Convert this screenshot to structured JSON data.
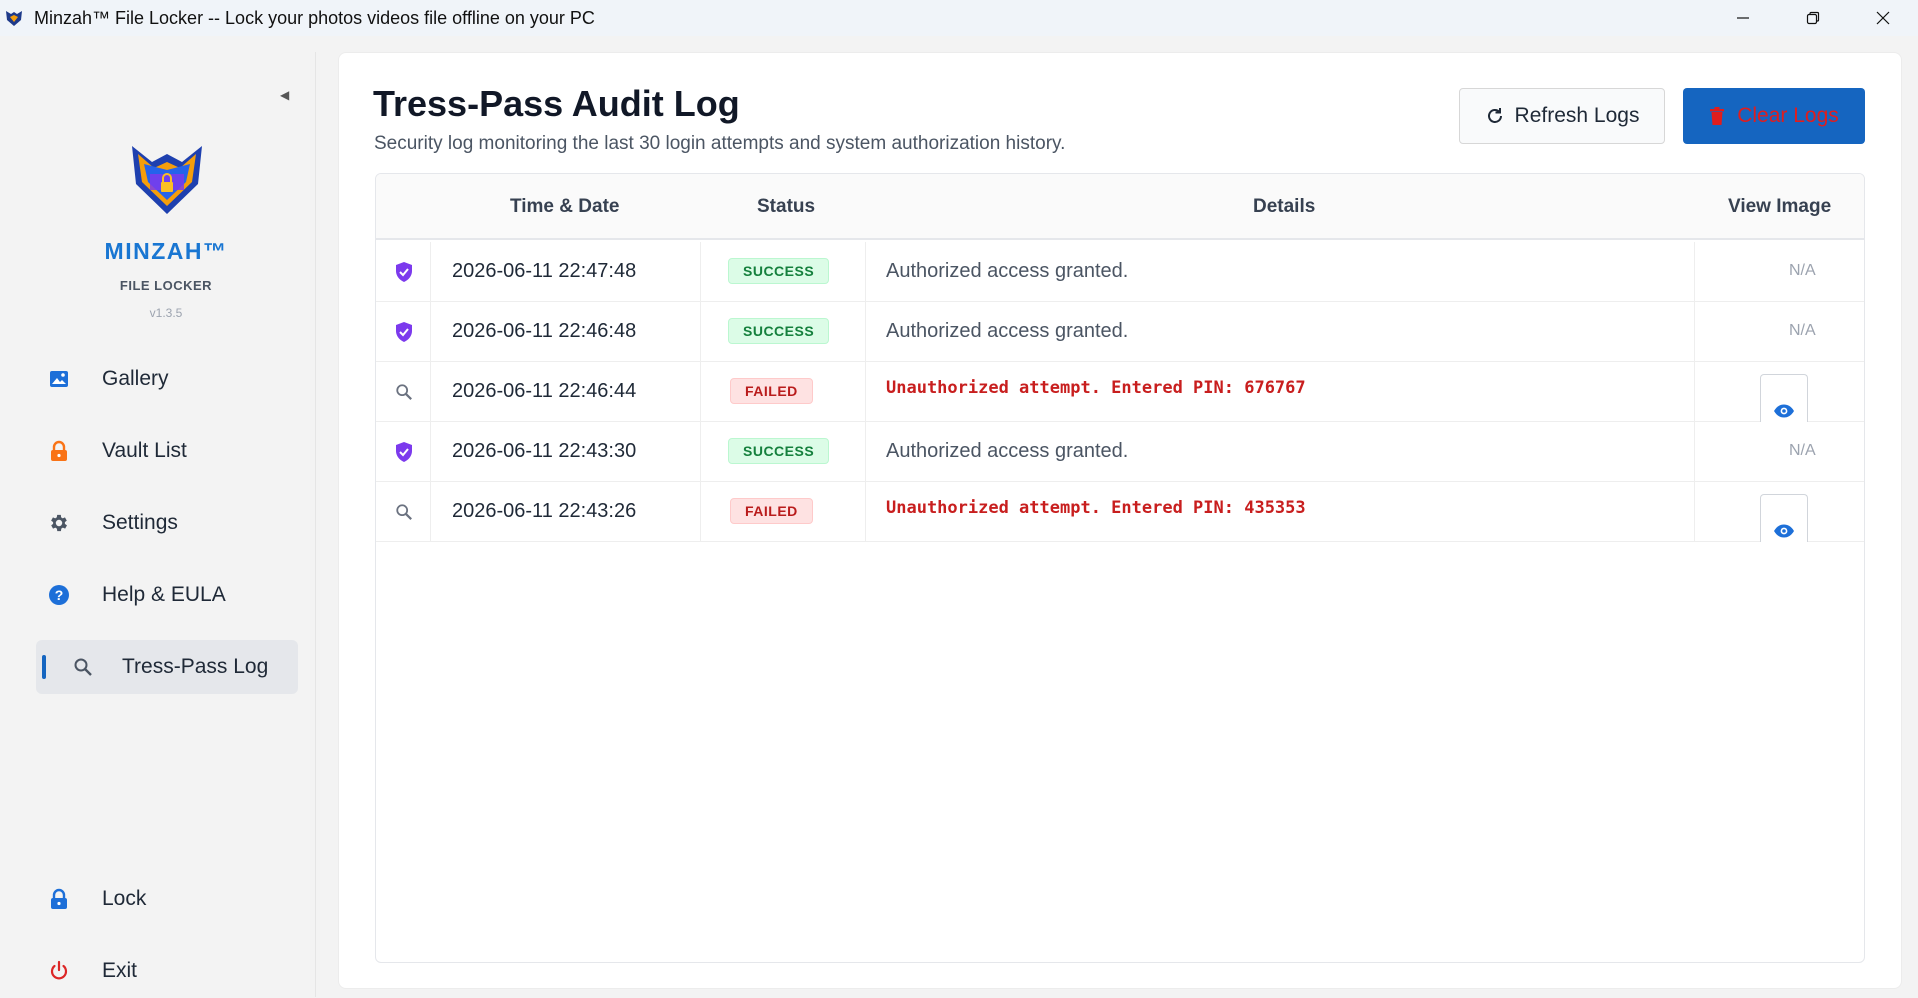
{
  "window": {
    "title": "Minzah™ File Locker -- Lock your photos videos file offline on your PC"
  },
  "sidebar": {
    "brand_name": "MINZAH™",
    "brand_sub": "FILE LOCKER",
    "version": "v1.3.5",
    "items": [
      {
        "label": "Gallery",
        "icon": "image-icon"
      },
      {
        "label": "Vault List",
        "icon": "lock-icon"
      },
      {
        "label": "Settings",
        "icon": "gear-icon"
      },
      {
        "label": "Help & EULA",
        "icon": "help-icon"
      },
      {
        "label": "Tress-Pass Log",
        "icon": "search-icon",
        "active": true
      }
    ],
    "bottom": [
      {
        "label": "Lock",
        "icon": "lock-icon"
      },
      {
        "label": "Exit",
        "icon": "power-icon"
      }
    ]
  },
  "page": {
    "title": "Tress-Pass Audit Log",
    "subtitle": "Security log monitoring the last 30 login attempts and system authorization history.",
    "refresh_label": "Refresh Logs",
    "clear_label": "Clear Logs"
  },
  "table": {
    "headers": [
      "Time & Date",
      "Status",
      "Details",
      "View Image"
    ],
    "rows": [
      {
        "time": "2026-06-11 22:47:48",
        "status": "SUCCESS",
        "details": "Authorized access granted.",
        "image": "N/A"
      },
      {
        "time": "2026-06-11 22:46:48",
        "status": "SUCCESS",
        "details": "Authorized access granted.",
        "image": "N/A"
      },
      {
        "time": "2026-06-11 22:46:44",
        "status": "FAILED",
        "details": "Unauthorized attempt. Entered PIN: 676767",
        "image": ""
      },
      {
        "time": "2026-06-11 22:43:30",
        "status": "SUCCESS",
        "details": "Authorized access granted.",
        "image": "N/A"
      },
      {
        "time": "2026-06-11 22:43:26",
        "status": "FAILED",
        "details": "Unauthorized attempt. Entered PIN: 435353",
        "image": ""
      }
    ]
  },
  "colors": {
    "accent": "#1565c0",
    "brand": "#1976d2",
    "success": "#15803d",
    "failed": "#c81e1e",
    "shield": "#7c3aed"
  }
}
